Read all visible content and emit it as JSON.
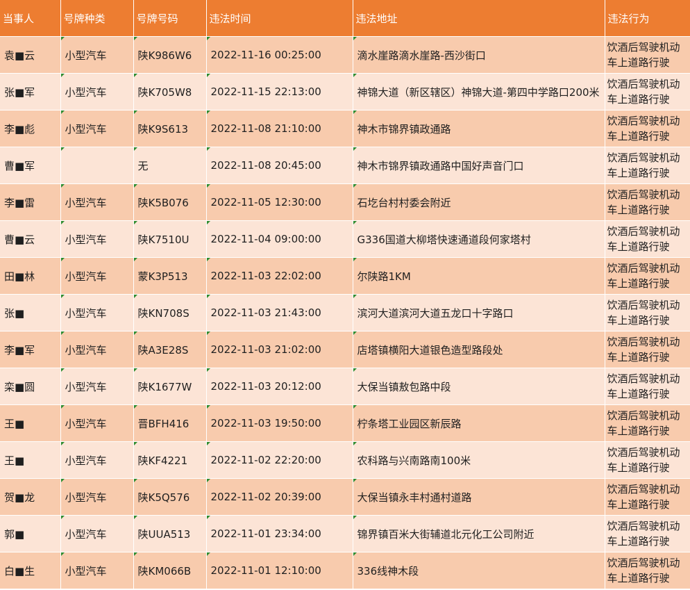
{
  "headers": [
    "当事人",
    "号牌种类",
    "号牌号码",
    "违法时间",
    "违法地址",
    "违法行为"
  ],
  "rows": [
    [
      "袁■云",
      "小型汽车",
      "陕K986W6",
      "2022-11-16 00:25:00",
      "滴水崖路滴水崖路-西沙街口",
      "饮酒后驾驶机动车上道路行驶"
    ],
    [
      "张■军",
      "小型汽车",
      "陕K705W8",
      "2022-11-15 22:13:00",
      "神锦大道（新区辖区）神锦大道-第四中学路口200米",
      "饮酒后驾驶机动车上道路行驶"
    ],
    [
      "李■彪",
      "小型汽车",
      "陕K9S613",
      "2022-11-08 21:10:00",
      "神木市锦界镇政通路",
      "饮酒后驾驶机动车上道路行驶"
    ],
    [
      "曹■军",
      "",
      "无",
      "2022-11-08 20:45:00",
      "神木市锦界镇政通路中国好声音门口",
      "饮酒后驾驶机动车上道路行驶"
    ],
    [
      "李■雷",
      "小型汽车",
      "陕K5B076",
      "2022-11-05 12:30:00",
      "石圪台村村委会附近",
      "饮酒后驾驶机动车上道路行驶"
    ],
    [
      "曹■云",
      "小型汽车",
      "陕K7510U",
      "2022-11-04 09:00:00",
      "G336国道大柳塔快速通道段何家塔村",
      "饮酒后驾驶机动车上道路行驶"
    ],
    [
      "田■林",
      "小型汽车",
      "蒙K3P513",
      "2022-11-03 22:02:00",
      "尔陕路1KM",
      "饮酒后驾驶机动车上道路行驶"
    ],
    [
      "张■",
      "小型汽车",
      "陕KN708S",
      "2022-11-03 21:43:00",
      "滨河大道滨河大道五龙口十字路口",
      "饮酒后驾驶机动车上道路行驶"
    ],
    [
      "李■军",
      "小型汽车",
      "陕A3E28S",
      "2022-11-03 21:02:00",
      "店塔镇横阳大道银色造型路段处",
      "饮酒后驾驶机动车上道路行驶"
    ],
    [
      "栾■圆",
      "小型汽车",
      "陕K1677W",
      "2022-11-03 20:12:00",
      "大保当镇敖包路中段",
      "饮酒后驾驶机动车上道路行驶"
    ],
    [
      "王■",
      "小型汽车",
      "晋BFH416",
      "2022-11-03 19:50:00",
      "柠条塔工业园区新辰路",
      "饮酒后驾驶机动车上道路行驶"
    ],
    [
      "王■",
      "小型汽车",
      "陕KF4221",
      "2022-11-02 22:20:00",
      "农科路与兴南路南100米",
      "饮酒后驾驶机动车上道路行驶"
    ],
    [
      "贺■龙",
      "小型汽车",
      "陕K5Q576",
      "2022-11-02 20:39:00",
      "大保当镇永丰村通村道路",
      "饮酒后驾驶机动车上道路行驶"
    ],
    [
      "郭■",
      "小型汽车",
      "陕UUA513",
      "2022-11-01 23:34:00",
      "锦界镇百米大街辅道北元化工公司附近",
      "饮酒后驾驶机动车上道路行驶"
    ],
    [
      "白■生",
      "小型汽车",
      "陕KM066B",
      "2022-11-01 12:10:00",
      "336线神木段",
      "饮酒后驾驶机动车上道路行驶"
    ]
  ],
  "colors": {
    "header_bg": "#ed7d31",
    "row_odd_bg": "#f8cbad",
    "row_even_bg": "#fce4d6",
    "cell_marker": "#2e8b2e"
  }
}
